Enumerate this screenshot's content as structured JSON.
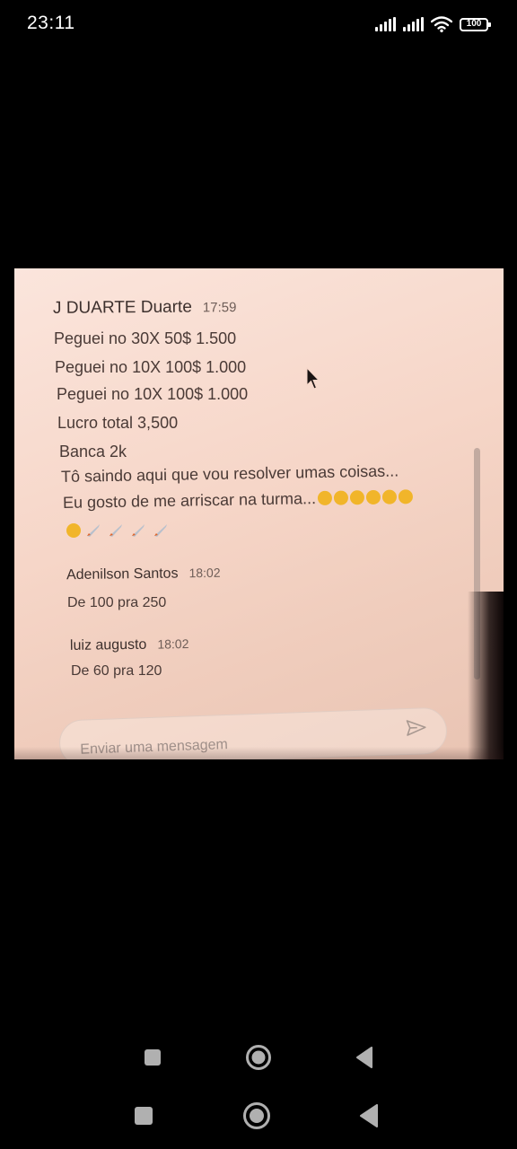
{
  "status_bar": {
    "time": "23:11",
    "battery": "100",
    "icons": [
      "signal-icon",
      "signal-icon",
      "wifi-icon",
      "battery-icon"
    ]
  },
  "chat": {
    "messages": [
      {
        "author": "J DUARTE Duarte",
        "time": "17:59",
        "lines": [
          "Peguei no 30X 50$ 1.500",
          "Peguei no 10X 100$ 1.000",
          "Peguei no 10X 100$  1.000",
          "Lucro total 3,500",
          "Banca 2k",
          "Tô saindo aqui que vou resolver umas coisas...",
          "Eu gosto de me arriscar na turma..."
        ],
        "emojis_line_7": [
          "cool-face-emoji",
          "cool-face-emoji",
          "cool-face-emoji",
          "zipper-face-emoji",
          "zipper-face-emoji",
          "zipper-face-emoji"
        ],
        "emojis_line_8": [
          "zipper-face-emoji",
          "rocket-emoji",
          "rocket-emoji",
          "rocket-emoji",
          "rocket-emoji"
        ]
      },
      {
        "author": "Adenilson Santos",
        "time": "18:02",
        "lines": [
          "De 100 pra 250"
        ]
      },
      {
        "author": "luiz augusto",
        "time": "18:02",
        "lines": [
          "De 60 pra 120"
        ]
      }
    ],
    "input": {
      "placeholder": "Enviar uma mensagem"
    }
  },
  "nav": {
    "buttons": [
      "recents-square-icon",
      "home-circle-icon",
      "back-triangle-icon"
    ]
  },
  "colors": {
    "background": "#000000",
    "photo_paper": "#f6d6c8",
    "text": "#4a3a36"
  }
}
